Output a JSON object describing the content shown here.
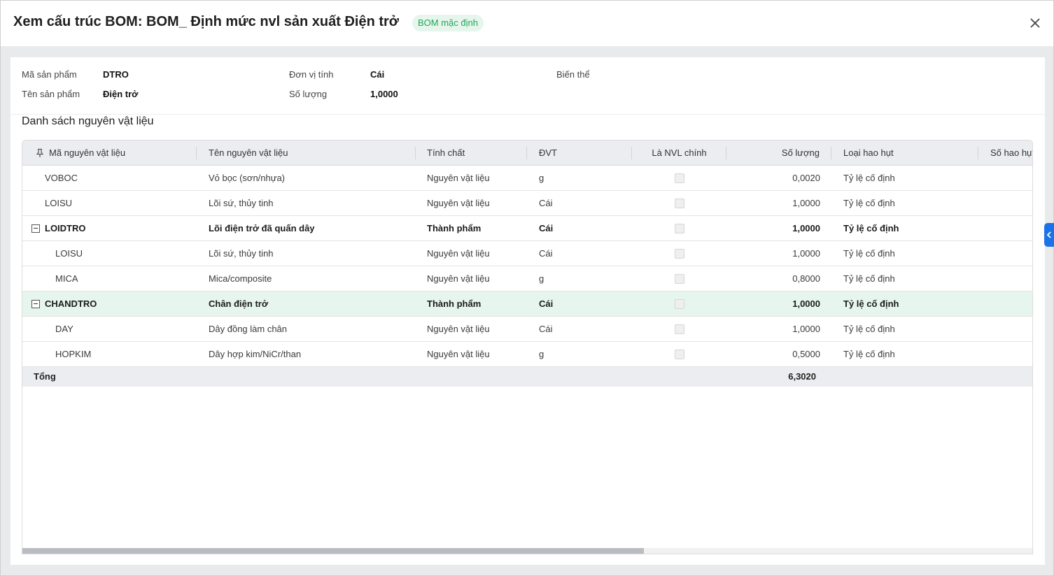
{
  "dialog": {
    "title": "Xem cấu trúc BOM: BOM_ Định mức nvl sản xuất Điện trở",
    "badge": "BOM mặc định",
    "close_icon": "close-icon"
  },
  "info": {
    "product_code_label": "Mã sản phẩm",
    "product_code_value": "DTRO",
    "product_name_label": "Tên sản phẩm",
    "product_name_value": "Điện trở",
    "unit_label": "Đơn vị tính",
    "unit_value": "Cái",
    "quantity_label": "Số lượng",
    "quantity_value": "1,0000",
    "variant_label": "Biến thể"
  },
  "materials": {
    "section_title": "Danh sách nguyên vật liệu",
    "columns": {
      "code": "Mã nguyên vật liệu",
      "name": "Tên nguyên vật liệu",
      "nature": "Tính chất",
      "unit": "ĐVT",
      "is_main": "Là NVL chính",
      "quantity": "Số lượng",
      "loss_type": "Loại hao hụt",
      "loss_qty": "Số hao hụt"
    },
    "rows": [
      {
        "code": "VOBOC",
        "name": "Vỏ bọc (sơn/nhựa)",
        "nature": "Nguyên vật liệu",
        "unit": "g",
        "quantity": "0,0020",
        "loss_type": "Tỷ lệ cố định"
      },
      {
        "code": "LOISU",
        "name": "Lõi sứ, thủy tinh",
        "nature": "Nguyên vật liệu",
        "unit": "Cái",
        "quantity": "1,0000",
        "loss_type": "Tỷ lệ cố định"
      },
      {
        "code": "LOIDTRO",
        "name": "Lõi điện trở đã quấn dây",
        "nature": "Thành phẩm",
        "unit": "Cái",
        "quantity": "1,0000",
        "loss_type": "Tỷ lệ cố định"
      },
      {
        "code": "LOISU",
        "name": "Lõi sứ, thủy tinh",
        "nature": "Nguyên vật liệu",
        "unit": "Cái",
        "quantity": "1,0000",
        "loss_type": "Tỷ lệ cố định"
      },
      {
        "code": "MICA",
        "name": "Mica/composite",
        "nature": "Nguyên vật liệu",
        "unit": "g",
        "quantity": "0,8000",
        "loss_type": "Tỷ lệ cố định"
      },
      {
        "code": "CHANDTRO",
        "name": "Chân điện trở",
        "nature": "Thành phẩm",
        "unit": "Cái",
        "quantity": "1,0000",
        "loss_type": "Tỷ lệ cố định"
      },
      {
        "code": "DAY",
        "name": "Dây đồng làm chân",
        "nature": "Nguyên vật liệu",
        "unit": "Cái",
        "quantity": "1,0000",
        "loss_type": "Tỷ lệ cố định"
      },
      {
        "code": "HOPKIM",
        "name": "Dây hợp kim/NiCr/than",
        "nature": "Nguyên vật liệu",
        "unit": "g",
        "quantity": "0,5000",
        "loss_type": "Tỷ lệ cố định"
      }
    ],
    "total_label": "Tổng",
    "total_quantity": "6,3020"
  },
  "icons": {
    "pin": "pin-icon",
    "collapse": "collapse-icon",
    "panel_toggle": "chevron-left-icon"
  },
  "colors": {
    "accent": "#1a73e8",
    "badge_bg": "#e6f6ec",
    "badge_text": "#23a55a",
    "selected_row": "#e6f5ee"
  }
}
